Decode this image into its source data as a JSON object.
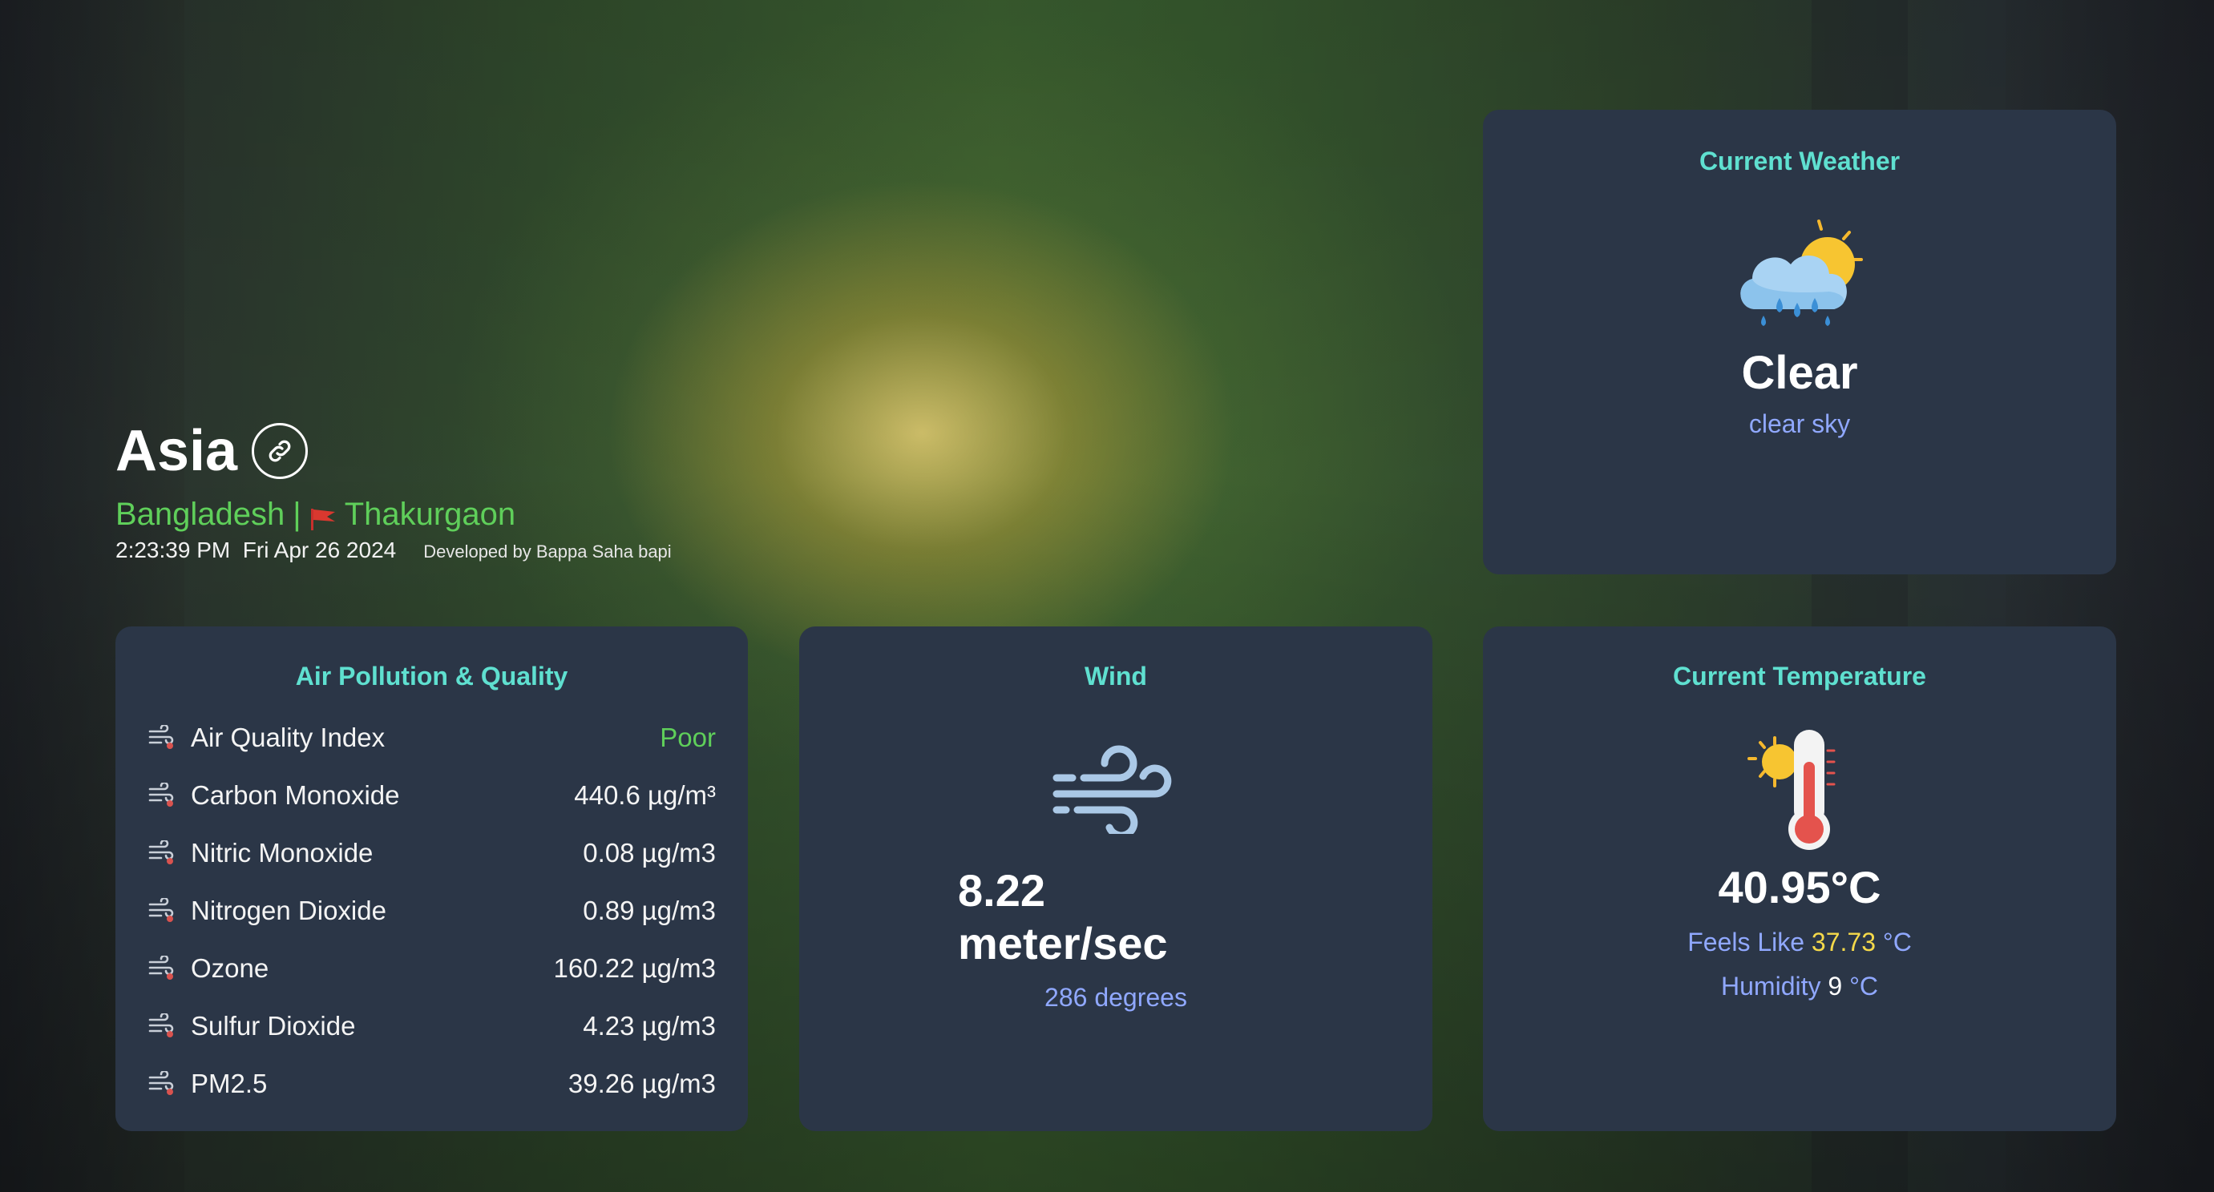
{
  "header": {
    "region": "Asia",
    "country": "Bangladesh",
    "separator": "|",
    "city": "Thakurgaon",
    "time": "2:23:39 PM",
    "date": "Fri Apr 26 2024",
    "credit": "Developed by Bappa Saha bapi"
  },
  "weather": {
    "title": "Current Weather",
    "main": "Clear",
    "description": "clear sky",
    "icon": "cloud-sun-rain-icon"
  },
  "air": {
    "title": "Air Pollution & Quality",
    "rows": [
      {
        "label": "Air Quality Index",
        "value": "Poor"
      },
      {
        "label": "Carbon Monoxide",
        "value": "440.6 µg/m³"
      },
      {
        "label": "Nitric Monoxide",
        "value": "0.08 µg/m3"
      },
      {
        "label": "Nitrogen Dioxide",
        "value": "0.89 µg/m3"
      },
      {
        "label": "Ozone",
        "value": "160.22 µg/m3"
      },
      {
        "label": "Sulfur Dioxide",
        "value": "4.23 µg/m3"
      },
      {
        "label": "PM2.5",
        "value": "39.26 µg/m3"
      }
    ]
  },
  "wind": {
    "title": "Wind",
    "speed_value": "8.22",
    "speed_unit": "meter/sec",
    "direction": "286 degrees",
    "icon": "wind-icon"
  },
  "temperature": {
    "title": "Current Temperature",
    "value": "40.95°C",
    "feels_label": "Feels Like",
    "feels_value": "37.73",
    "feels_unit": "°C",
    "humidity_label": "Humidity",
    "humidity_value": "9",
    "humidity_unit": "°C",
    "icon": "thermometer-sun-icon"
  },
  "colors": {
    "card_bg": "#2b3647",
    "title_teal": "#5fe0d0",
    "accent_blue": "#90a8ff",
    "green": "#5fcf5a",
    "yellow": "#f5d94a"
  }
}
